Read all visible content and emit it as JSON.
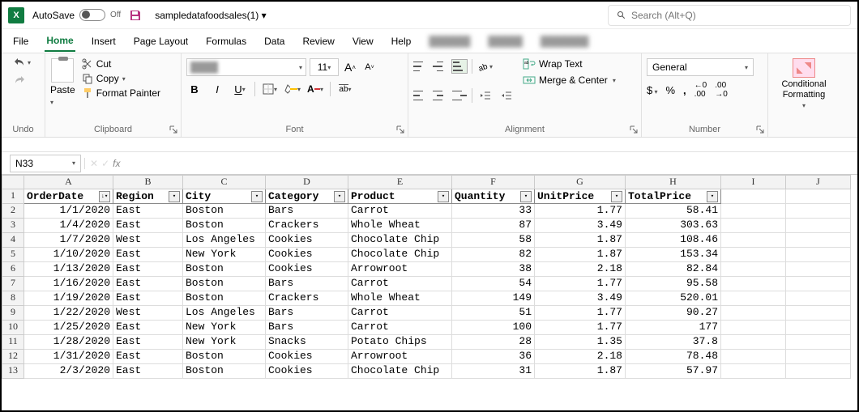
{
  "titlebar": {
    "autosave_label": "AutoSave",
    "autosave_state": "Off",
    "filename": "sampledatafoodsales(1) ▾",
    "search_placeholder": "Search (Alt+Q)"
  },
  "menutabs": [
    "File",
    "Home",
    "Insert",
    "Page Layout",
    "Formulas",
    "Data",
    "Review",
    "View",
    "Help"
  ],
  "active_tab": "Home",
  "ribbon": {
    "undo_group": "Undo",
    "clipboard": {
      "label": "Clipboard",
      "paste": "Paste",
      "cut": "Cut",
      "copy": "Copy",
      "format_painter": "Format Painter"
    },
    "font": {
      "label": "Font",
      "name": "",
      "size": "11"
    },
    "alignment": {
      "label": "Alignment",
      "wrap": "Wrap Text",
      "merge": "Merge & Center"
    },
    "number": {
      "label": "Number",
      "format": "General"
    },
    "cond": {
      "label": "Conditional Formatting"
    }
  },
  "namebox": "N33",
  "columns": [
    "A",
    "B",
    "C",
    "D",
    "E",
    "F",
    "G",
    "H",
    "I",
    "J"
  ],
  "headers": [
    "OrderDate",
    "Region",
    "City",
    "Category",
    "Product",
    "Quantity",
    "UnitPrice",
    "TotalPrice"
  ],
  "chart_data": {
    "type": "table",
    "columns": [
      "OrderDate",
      "Region",
      "City",
      "Category",
      "Product",
      "Quantity",
      "UnitPrice",
      "TotalPrice"
    ],
    "rows": [
      [
        "1/1/2020",
        "East",
        "Boston",
        "Bars",
        "Carrot",
        33,
        1.77,
        58.41
      ],
      [
        "1/4/2020",
        "East",
        "Boston",
        "Crackers",
        "Whole Wheat",
        87,
        3.49,
        303.63
      ],
      [
        "1/7/2020",
        "West",
        "Los Angeles",
        "Cookies",
        "Chocolate Chip",
        58,
        1.87,
        108.46
      ],
      [
        "1/10/2020",
        "East",
        "New York",
        "Cookies",
        "Chocolate Chip",
        82,
        1.87,
        153.34
      ],
      [
        "1/13/2020",
        "East",
        "Boston",
        "Cookies",
        "Arrowroot",
        38,
        2.18,
        82.84
      ],
      [
        "1/16/2020",
        "East",
        "Boston",
        "Bars",
        "Carrot",
        54,
        1.77,
        95.58
      ],
      [
        "1/19/2020",
        "East",
        "Boston",
        "Crackers",
        "Whole Wheat",
        149,
        3.49,
        520.01
      ],
      [
        "1/22/2020",
        "West",
        "Los Angeles",
        "Bars",
        "Carrot",
        51,
        1.77,
        90.27
      ],
      [
        "1/25/2020",
        "East",
        "New York",
        "Bars",
        "Carrot",
        100,
        1.77,
        177
      ],
      [
        "1/28/2020",
        "East",
        "New York",
        "Snacks",
        "Potato Chips",
        28,
        1.35,
        37.8
      ],
      [
        "1/31/2020",
        "East",
        "Boston",
        "Cookies",
        "Arrowroot",
        36,
        2.18,
        78.48
      ],
      [
        "2/3/2020",
        "East",
        "Boston",
        "Cookies",
        "Chocolate Chip",
        31,
        1.87,
        57.97
      ]
    ]
  }
}
